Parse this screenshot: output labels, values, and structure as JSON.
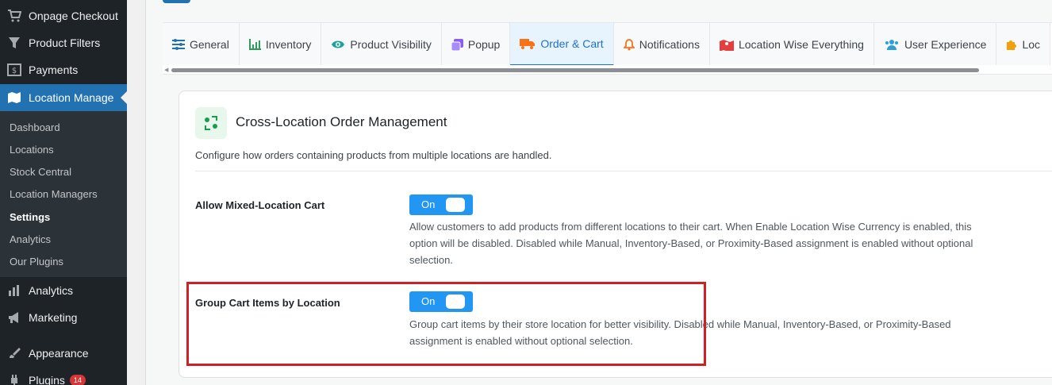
{
  "sidebar": {
    "menu": [
      {
        "label": "Onpage Checkout",
        "icon": "cart-icon"
      },
      {
        "label": "Product Filters",
        "icon": "filter-icon"
      },
      {
        "label": "Payments",
        "icon": "dollar-icon"
      },
      {
        "label": "Location Manage",
        "icon": "map-icon"
      }
    ],
    "submenu": [
      {
        "label": "Dashboard"
      },
      {
        "label": "Locations"
      },
      {
        "label": "Stock Central"
      },
      {
        "label": "Location Managers"
      },
      {
        "label": "Settings"
      },
      {
        "label": "Analytics"
      },
      {
        "label": "Our Plugins"
      }
    ],
    "menu_bottom": [
      {
        "label": "Analytics",
        "icon": "bar-chart-icon"
      },
      {
        "label": "Marketing",
        "icon": "megaphone-icon"
      },
      {
        "label": "Appearance",
        "icon": "brush-icon"
      },
      {
        "label": "Plugins",
        "icon": "plugin-icon",
        "badge": "14"
      }
    ]
  },
  "tabs": [
    {
      "label": "General",
      "icon": "sliders-icon",
      "color": "#2271b1"
    },
    {
      "label": "Inventory",
      "icon": "chart-icon",
      "color": "#2e9d5b"
    },
    {
      "label": "Product Visibility",
      "icon": "eye-icon",
      "color": "#1aa39a"
    },
    {
      "label": "Popup",
      "icon": "popup-icon",
      "color": "#8b5cf6"
    },
    {
      "label": "Order & Cart",
      "icon": "truck-icon",
      "color": "#f97316"
    },
    {
      "label": "Notifications",
      "icon": "bell-icon",
      "color": "#f97316"
    },
    {
      "label": "Location Wise Everything",
      "icon": "map-pin-icon",
      "color": "#e53e3e"
    },
    {
      "label": "User Experience",
      "icon": "users-icon",
      "color": "#2b9fd6"
    },
    {
      "label": "Loc",
      "icon": "puzzle-icon",
      "color": "#f59e0b"
    }
  ],
  "active_tab": "Order & Cart",
  "section": {
    "title": "Cross-Location Order Management",
    "description": "Configure how orders containing products from multiple locations are handled.",
    "icon": "exchange-icon"
  },
  "settings": [
    {
      "label": "Allow Mixed-Location Cart",
      "toggle": "On",
      "help_lines": [
        "Allow customers to add products from different locations to their cart. When Enable Location Wise Currency is enabled, this",
        "option will be disabled. Disabled while Manual, Inventory-Based, or Proximity-Based assignment is enabled without optional",
        "selection."
      ]
    },
    {
      "label": "Group Cart Items by Location",
      "toggle": "On",
      "help_lines": [
        "Group cart items by their store location for better visibility. Disabled while Manual, Inventory-Based, or Proximity-Based",
        "assignment is enabled without optional selection."
      ]
    }
  ],
  "colors": {
    "accent": "#2271b1",
    "toggle": "#2196f3",
    "highlight": "#d11f26"
  }
}
